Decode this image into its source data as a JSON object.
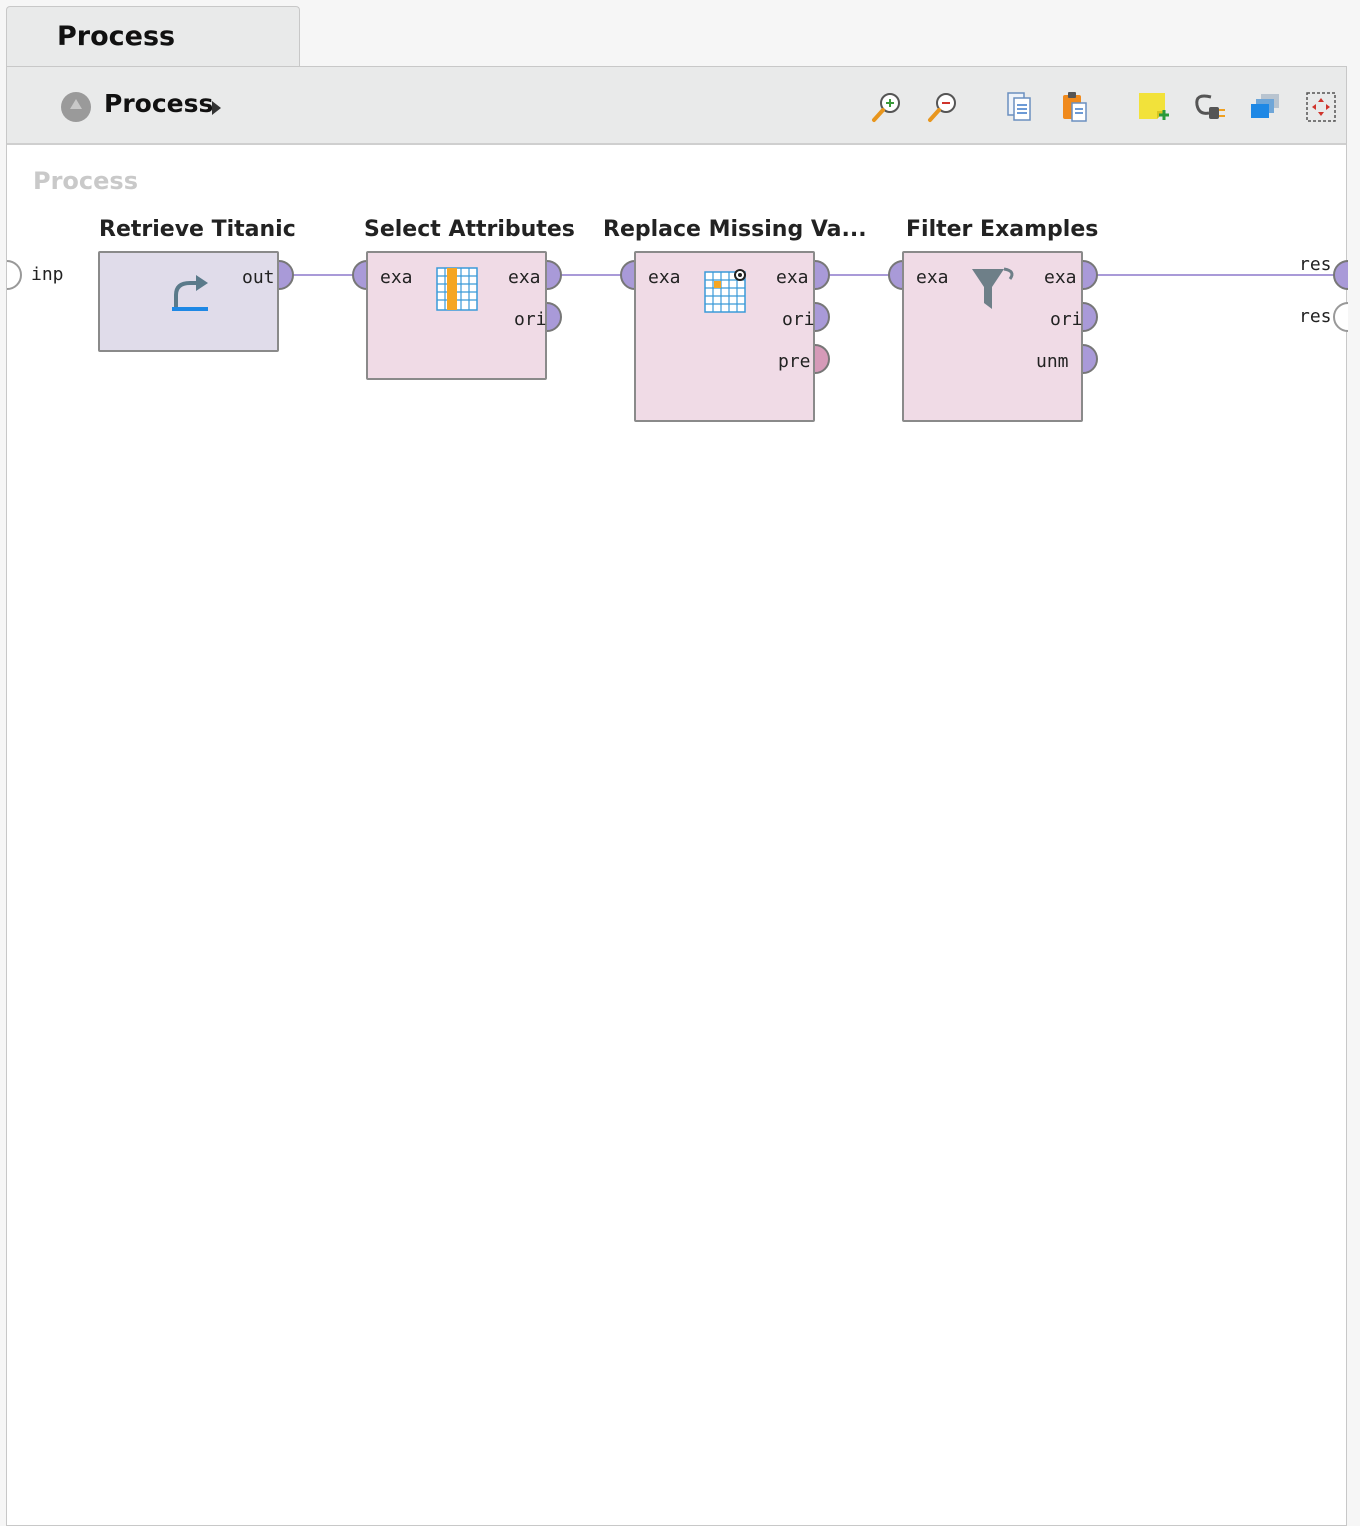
{
  "tab": {
    "label": "Process"
  },
  "toolbar": {
    "breadcrumb": "Process",
    "icons": [
      "zoom-in-icon",
      "zoom-out-icon",
      "copy-icon",
      "paste-icon",
      "add-note-icon",
      "auto-wire-icon",
      "arrange-icon",
      "fit-icon"
    ]
  },
  "canvas": {
    "title": "Process",
    "input_port": "inp",
    "result_ports": [
      "res",
      "res"
    ]
  },
  "operators": [
    {
      "name": "Retrieve Titanic",
      "inputs": [],
      "outputs": [
        "out"
      ],
      "color": "#e0dcea"
    },
    {
      "name": "Select Attributes",
      "inputs": [
        "exa"
      ],
      "outputs": [
        "exa",
        "ori"
      ],
      "color": "#f0dbe6"
    },
    {
      "name": "Replace Missing Va...",
      "inputs": [
        "exa"
      ],
      "outputs": [
        "exa",
        "ori",
        "pre"
      ],
      "color": "#f0dbe6"
    },
    {
      "name": "Filter Examples",
      "inputs": [
        "exa"
      ],
      "outputs": [
        "exa",
        "ori",
        "unm"
      ],
      "color": "#f0dbe6"
    }
  ],
  "colors": {
    "wire": "#a99ad8",
    "port": "#a99ad8",
    "port_pre": "#d59ab8"
  }
}
